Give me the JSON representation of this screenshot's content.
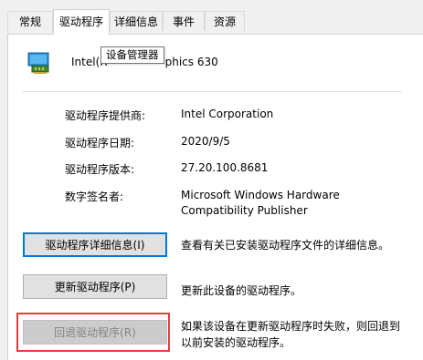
{
  "tabs": [
    {
      "label": "常规",
      "active": false
    },
    {
      "label": "驱动程序",
      "active": true
    },
    {
      "label": "详细信息",
      "active": false
    },
    {
      "label": "事件",
      "active": false
    },
    {
      "label": "资源",
      "active": false
    }
  ],
  "device": {
    "icon": "display-adapter-icon",
    "name_start": "Intel(R",
    "name_end": "phics 630"
  },
  "tooltip": "设备管理器",
  "properties": [
    {
      "label": "驱动程序提供商:",
      "value": "Intel Corporation"
    },
    {
      "label": "驱动程序日期:",
      "value": "2020/9/5"
    },
    {
      "label": "驱动程序版本:",
      "value": "27.20.100.8681"
    },
    {
      "label": "数字签名者:",
      "value_line1": "Microsoft Windows Hardware",
      "value_line2": "Compatibility Publisher"
    }
  ],
  "actions": [
    {
      "button": "驱动程序详细信息(I)",
      "description": "查看有关已安装驱动程序文件的详细信息。",
      "focused": true,
      "enabled": true
    },
    {
      "button": "更新驱动程序(P)",
      "description": "更新此设备的驱动程序。",
      "enabled": true
    },
    {
      "button": "回退驱动程序(R)",
      "description_line1": "如果该设备在更新驱动程序时失败，则回退到",
      "description_line2": "以前安装的驱动程序。",
      "enabled": false,
      "highlighted": true
    }
  ],
  "colors": {
    "focus_border": "#0078d7",
    "highlight_border": "#e03c3c"
  }
}
